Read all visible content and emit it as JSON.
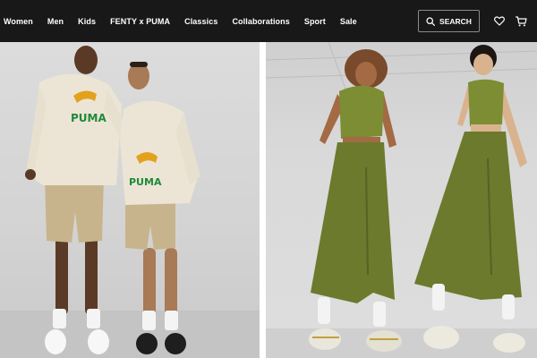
{
  "nav": {
    "items": [
      "Women",
      "Men",
      "Kids",
      "FENTY x PUMA",
      "Classics",
      "Collaborations",
      "Sport",
      "Sale"
    ]
  },
  "header": {
    "search_label": "SEARCH",
    "icons": [
      "search-icon",
      "heart-icon",
      "cart-icon"
    ]
  },
  "hero": {
    "left_image": "men-puma-hoodies-shorts-photo",
    "right_image": "women-green-skirts-crop-tops-photo",
    "logo_text": "PUMA"
  },
  "colors": {
    "header_bg": "#181818",
    "hoodie_cream": "#ece5d6",
    "shorts_khaki": "#c8b48c",
    "olive": "#6b7a2c",
    "puma_green": "#1f8a3a",
    "puma_gold": "#e2a21c"
  }
}
